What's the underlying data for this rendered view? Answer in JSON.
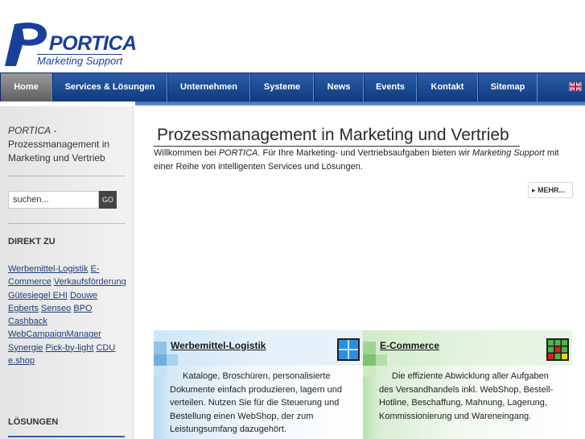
{
  "logo": {
    "name": "PORTICA",
    "tagline": "Marketing Support"
  },
  "nav": {
    "items": [
      {
        "label": "Home",
        "active": true
      },
      {
        "label": "Services & Lösungen",
        "active": false
      },
      {
        "label": "Unternehmen",
        "active": false
      },
      {
        "label": "Systeme",
        "active": false
      },
      {
        "label": "News",
        "active": false
      },
      {
        "label": "Events",
        "active": false
      },
      {
        "label": "Kontakt",
        "active": false
      },
      {
        "label": "Sitemap",
        "active": false
      }
    ],
    "language_icon": "uk-flag-icon"
  },
  "sidebar": {
    "intro_brand": "PORTICA",
    "intro_rest": " - Prozessmanagement in Marketing und Vertrieb",
    "search_placeholder": "suchen...",
    "search_button": "GO",
    "direkt_heading": "DIREKT ZU",
    "links": [
      "Werbemittel-Logistik",
      "E-Commerce",
      "Verkaufsförderung",
      "Gütesiegel EHI",
      "Douwe Egberts",
      "Senseo",
      "BPO Cashback",
      "WebCampaignManager",
      "Synergie",
      "Pick-by-light",
      "CDU e.shop"
    ],
    "loesungen_heading": "LÖSUNGEN"
  },
  "main": {
    "title": "Prozessmanagement in Marketing und Vertrieb",
    "welcome_1": "Willkommen bei ",
    "welcome_brand": "PORTICA",
    "welcome_2": ". Für Ihre Marketing- und Vertriebsaufgaben bieten wir ",
    "welcome_ms": "Marketing Support",
    "welcome_3": " mit einer Reihe von intelligenten Services und Lösungen.",
    "more_label": "MEHR..."
  },
  "panels": [
    {
      "title": "Werbemittel-Logistik",
      "text": "Kataloge, Broschüren, personalisierte Dokumente einfach produzieren, lagern und verteilen. Nutzen Sie für die Steuerung und Bestellung einen WebShop, der zum Leistungsumfang dazugehört.",
      "accent": "#2c8ad8"
    },
    {
      "title": "E-Commerce",
      "text": "Die effiziente Abwicklung aller Aufgaben des Versandhandels inkl. WebShop, Bestell-Hotline, Beschaffung, Mahnung, Lagerung, Kommissionierung und Wareneingang.",
      "accent": "#3aa33a"
    }
  ],
  "colors": {
    "nav_blue": "#1c4a93",
    "link_blue": "#1f3d7a",
    "logo_blue": "#1a3f9a"
  }
}
